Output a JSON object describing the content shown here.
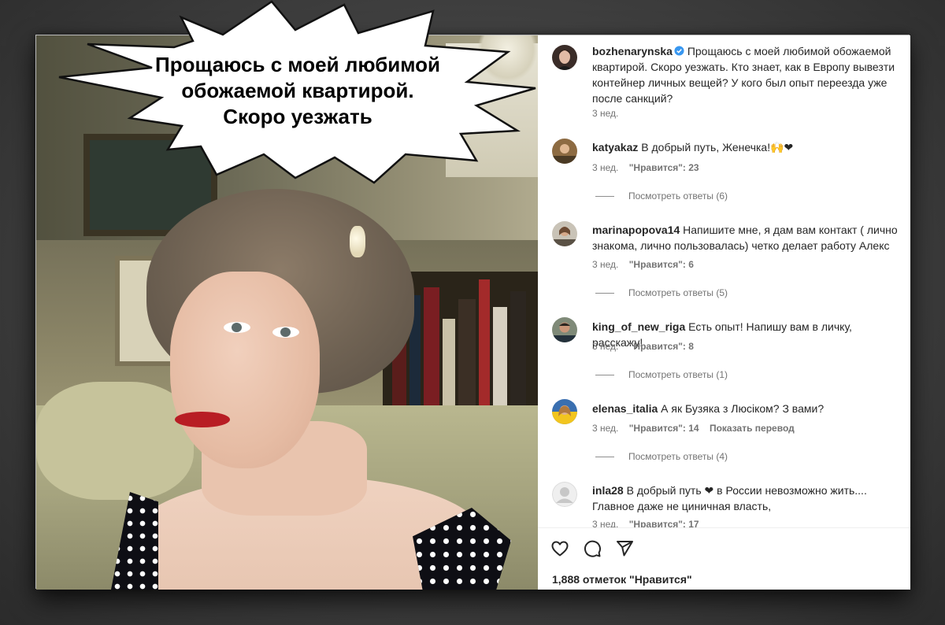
{
  "caption_bubble": {
    "text": "Прощаюсь с моей любимой обожаемой квартирой. Скоро уезжать"
  },
  "post": {
    "author": "bozhenarynska",
    "verified_icon": "verified-badge-icon",
    "caption": "Прощаюсь с моей любимой обожаемой квартирой. Скоро уезжать. Кто знает, как в Европу вывезти контейнер личных вещей? У кого был опыт переезда уже после санкций?",
    "time": "3 нед.",
    "likes": "1,888 отметок \"Нравится\""
  },
  "comments": [
    {
      "user": "katyakaz",
      "text": "В добрый путь, Женечка!🙌❤",
      "time": "3 нед.",
      "likes": "\"Нравится\": 23",
      "translate": "",
      "replies": "Посмотреть ответы (6)"
    },
    {
      "user": "marinapopova14",
      "text": "Напишите мне, я дам вам контакт ( лично знакома, лично пользовалась) четко делает работу Алекс",
      "time": "3 нед.",
      "likes": "\"Нравится\": 6",
      "translate": "",
      "replies": "Посмотреть ответы (5)"
    },
    {
      "user": "king_of_new_riga",
      "text": "Есть опыт! Напишу вам в личку, расскажу!",
      "time": "3 нед.",
      "likes": "\"Нравится\": 8",
      "translate": "",
      "replies": "Посмотреть ответы (1)"
    },
    {
      "user": "elenas_italia",
      "text": "А як Бузяка з Люсіком? З вами?",
      "time": "3 нед.",
      "likes": "\"Нравится\": 14",
      "translate": "Показать перевод",
      "replies": "Посмотреть ответы (4)"
    },
    {
      "user": "inla28",
      "text": "В добрый путь ❤ в России невозможно жить.... Главное даже не циничная власть,",
      "time": "3 нед.",
      "likes": "\"Нравится\": 17",
      "translate": "",
      "replies": ""
    }
  ],
  "icons": {
    "like": "heart-icon",
    "comment": "comment-icon",
    "share": "share-icon"
  }
}
